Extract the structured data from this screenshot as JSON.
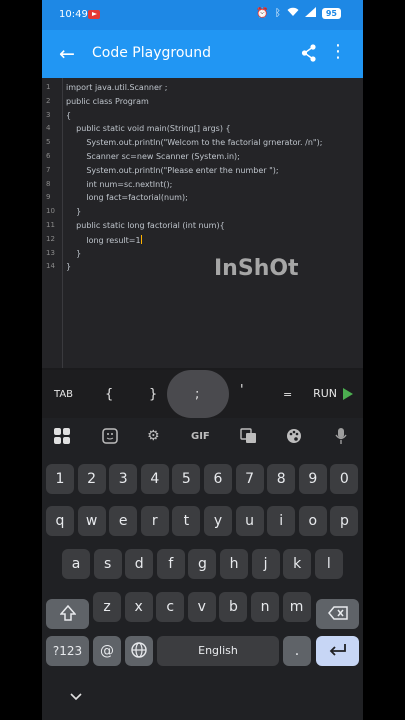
{
  "status": {
    "time": "10:49",
    "battery": "95"
  },
  "appbar": {
    "title": "Code Playground"
  },
  "editor": {
    "lines": [
      {
        "n": "1",
        "text": "import java.util.Scanner ;"
      },
      {
        "n": "2",
        "text": "public class Program"
      },
      {
        "n": "3",
        "text": "{"
      },
      {
        "n": "4",
        "text": "    public static void main(String[] args) {"
      },
      {
        "n": "5",
        "text": "        System.out.println(\"Welcom to the factorial grnerator. /n\");"
      },
      {
        "n": "6",
        "text": "        Scanner sc=new Scanner (System.in);"
      },
      {
        "n": "7",
        "text": "        System.out.println(\"Please enter the number \");"
      },
      {
        "n": "8",
        "text": "        int num=sc.nextInt();"
      },
      {
        "n": "9",
        "text": "        long fact=factorial(num);"
      },
      {
        "n": "10",
        "text": "    }"
      },
      {
        "n": "11",
        "text": "    public static long factorial (int num){"
      },
      {
        "n": "12",
        "text": "        long result=1"
      },
      {
        "n": "13",
        "text": "    }"
      },
      {
        "n": "14",
        "text": "}"
      }
    ]
  },
  "symbols": {
    "tab": "TAB",
    "lbrace": "{",
    "rbrace": "}",
    "semicolon": ";",
    "quote": "'",
    "equals": "=",
    "run": "RUN"
  },
  "keyboard": {
    "row1": [
      "1",
      "2",
      "3",
      "4",
      "5",
      "6",
      "7",
      "8",
      "9",
      "0"
    ],
    "row2": [
      "q",
      "w",
      "e",
      "r",
      "t",
      "y",
      "u",
      "i",
      "o",
      "p"
    ],
    "row3": [
      "a",
      "s",
      "d",
      "f",
      "g",
      "h",
      "j",
      "k",
      "l"
    ],
    "row4": [
      "z",
      "x",
      "c",
      "v",
      "b",
      "n",
      "m"
    ],
    "symbols_key": "?123",
    "at_key": "@",
    "space": "English",
    "period": ".",
    "gif": "GIF"
  },
  "watermark": "InShOt"
}
